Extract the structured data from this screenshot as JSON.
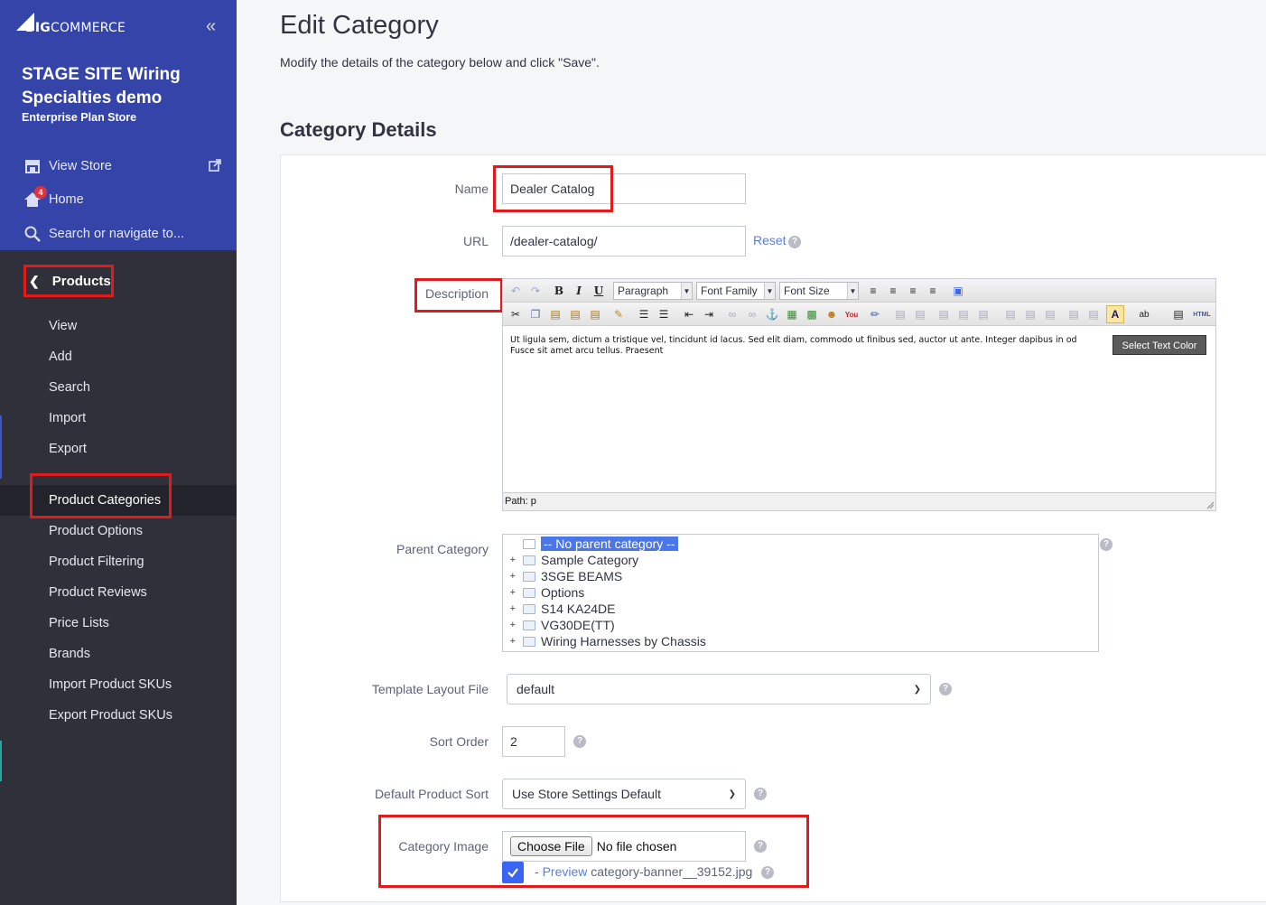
{
  "sidebar": {
    "logo": {
      "prefix": "BIG",
      "suffix": "COMMERCE"
    },
    "store_name": "STAGE SITE Wiring Specialties demo",
    "plan": "Enterprise Plan Store",
    "view_store": "View Store",
    "home": "Home",
    "home_badge": "4",
    "search": "Search or navigate to...",
    "section": "Products",
    "items": [
      {
        "label": "View"
      },
      {
        "label": "Add"
      },
      {
        "label": "Search"
      },
      {
        "label": "Import"
      },
      {
        "label": "Export"
      },
      {
        "label": "Product Categories",
        "active": true
      },
      {
        "label": "Product Options"
      },
      {
        "label": "Product Filtering"
      },
      {
        "label": "Product Reviews"
      },
      {
        "label": "Price Lists"
      },
      {
        "label": "Brands"
      },
      {
        "label": "Import Product SKUs"
      },
      {
        "label": "Export Product SKUs"
      }
    ]
  },
  "page": {
    "title": "Edit Category",
    "subtitle": "Modify the details of the category below and click \"Save\".",
    "section_title": "Category Details"
  },
  "form": {
    "name_label": "Name",
    "name_value": "Dealer Catalog",
    "url_label": "URL",
    "url_value": "/dealer-catalog/",
    "reset_label": "Reset",
    "description_label": "Description",
    "editor": {
      "block_format": "Paragraph",
      "font_family": "Font Family",
      "font_size": "Font Size",
      "content_line1": "Ut ligula sem, dictum a tristique vel, tincidunt id lacus. Sed elit diam, commodo ut finibus sed, auctor ut ante. Integer dapibus in od",
      "content_line2": "Fusce sit amet arcu tellus. Praesent",
      "path": "Path: p",
      "tooltip": "Select Text Color",
      "html_label": "HTML"
    },
    "parent_label": "Parent Category",
    "parent_tree": [
      {
        "label": "-- No parent category --",
        "selected": true
      },
      {
        "label": "Sample Category"
      },
      {
        "label": "3SGE BEAMS"
      },
      {
        "label": "Options"
      },
      {
        "label": "S14 KA24DE"
      },
      {
        "label": "VG30DE(TT)"
      },
      {
        "label": "Wiring Harnesses by Chassis"
      }
    ],
    "template_label": "Template Layout File",
    "template_value": "default",
    "sort_order_label": "Sort Order",
    "sort_order_value": "2",
    "default_sort_label": "Default Product Sort",
    "default_sort_value": "Use Store Settings Default",
    "image_label": "Category Image",
    "choose_file": "Choose File",
    "no_file": "No file chosen",
    "preview_dash": "-",
    "preview_link": "Preview",
    "image_filename": "category-banner__39152.jpg"
  },
  "colors": {
    "sidebar_top": "#3444a8",
    "sidebar_bottom": "#2f3039",
    "accent": "#3c64f4",
    "link": "#5a7fd8",
    "highlight_box": "#e11b1b"
  },
  "icons": [
    "bigcommerce-logo",
    "collapse-sidebar-icon",
    "storefront-icon",
    "external-link-icon",
    "home-icon",
    "search-icon",
    "chevron-left-icon",
    "help-icon",
    "folder-icon",
    "checkmark-icon"
  ]
}
